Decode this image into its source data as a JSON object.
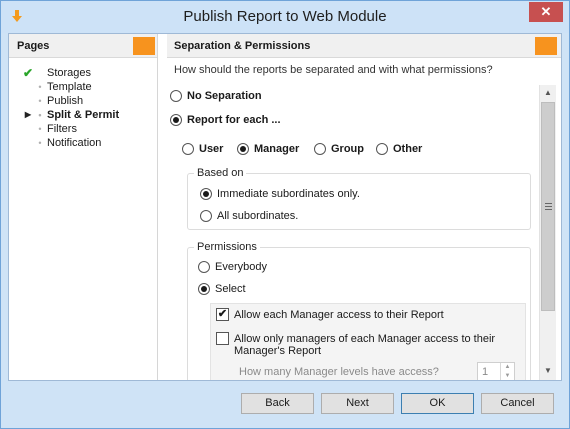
{
  "window": {
    "title": "Publish Report to Web Module",
    "close_label": "✕"
  },
  "pages_panel": {
    "header": "Pages",
    "items": [
      {
        "label": "Storages",
        "state": "done"
      },
      {
        "label": "Template",
        "state": "pending"
      },
      {
        "label": "Publish",
        "state": "pending"
      },
      {
        "label": "Split & Permit",
        "state": "current"
      },
      {
        "label": "Filters",
        "state": "pending"
      },
      {
        "label": "Notification",
        "state": "pending"
      }
    ]
  },
  "content": {
    "header": "Separation & Permissions",
    "question": "How should the reports be separated and with what permissions?",
    "separation": {
      "no_separation": "No Separation",
      "report_for_each": "Report for each ...",
      "selected": "report_for_each",
      "entity_options": [
        "User",
        "Manager",
        "Group",
        "Other"
      ],
      "entity_selected": "Manager"
    },
    "based_on": {
      "legend": "Based on",
      "options": [
        "Immediate subordinates only.",
        "All subordinates."
      ],
      "selected_index": 0
    },
    "permissions": {
      "legend": "Permissions",
      "options": [
        "Everybody",
        "Select"
      ],
      "selected_index": 1,
      "allow_each": {
        "label": "Allow each Manager access to their Report",
        "checked": true
      },
      "allow_only": {
        "label_line1": "Allow only managers of each Manager access to their",
        "label_line2": "Manager's Report",
        "checked": false
      },
      "levels": {
        "label": "How many Manager levels have access?",
        "value": "1"
      }
    }
  },
  "buttons": {
    "back": "Back",
    "next": "Next",
    "ok": "OK",
    "cancel": "Cancel"
  },
  "colors": {
    "accent_orange": "#f7931e",
    "titlebar": "#cde2f7",
    "close_red": "#c75050",
    "check_green": "#2aa52a"
  }
}
